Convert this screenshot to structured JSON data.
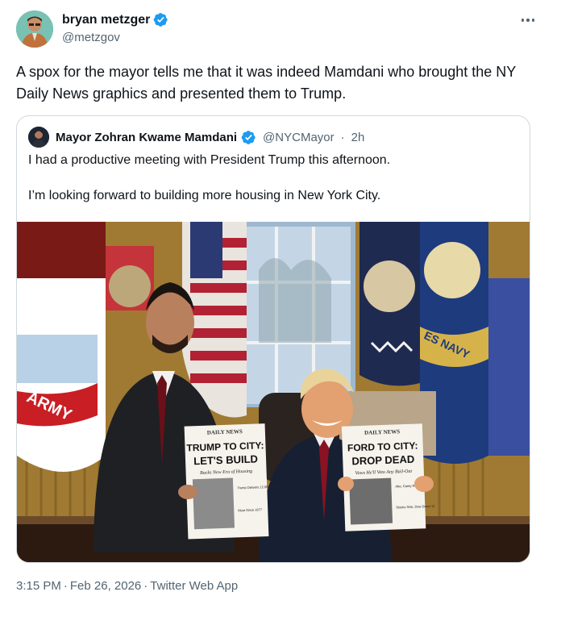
{
  "author": {
    "display_name": "bryan metzger",
    "handle": "@metzgov",
    "avatar_icon": "person-avatar-icon"
  },
  "tweet": {
    "text": "A spox for the mayor tells me that it was indeed Mamdani who brought the NY Daily News graphics and presented them to Trump."
  },
  "quoted": {
    "display_name": "Mayor Zohran Kwame Mamdani",
    "handle": "@NYCMayor",
    "dot": "·",
    "time": "2h",
    "paragraphs": [
      "I had a productive meeting with President Trump this afternoon.",
      "I’m looking forward to building more housing in New York City."
    ],
    "photo": {
      "left_paper": {
        "masthead": "DAILY NEWS",
        "headline_line1": "TRUMP TO CITY:",
        "headline_line2": "LET'S BUILD",
        "subhead": "Backs New Era of Housing",
        "side1": "Trump Delivers 12,000+ Homes",
        "side2": "Must Since 1977"
      },
      "right_paper": {
        "masthead": "DAILY NEWS",
        "headline_line1": "FORD TO CITY:",
        "headline_line2": "DROP DEAD",
        "subhead": "Vows He'll Veto Any Bail-Out",
        "side1": "Abe, Carey Rip Stand",
        "side2": "Stocks Sink, Dow Down 12"
      },
      "flag_text_army": "ARMY",
      "flag_text_navy": "ES NAVY"
    }
  },
  "footer": {
    "time": "3:15 PM",
    "date": "Feb 26, 2026",
    "source": "Twitter Web App",
    "sep": "·"
  },
  "colors": {
    "verified_blue": "#1d9bf0",
    "secondary_text": "#536471",
    "border": "#cfd9de"
  }
}
